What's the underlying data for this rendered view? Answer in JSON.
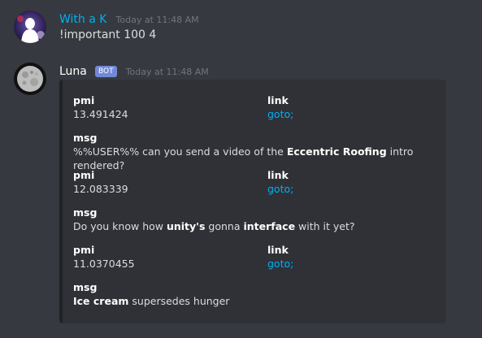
{
  "messages": [
    {
      "author": "With a K",
      "author_color": "#00aff4",
      "timestamp": "Today at 11:48 AM",
      "content": "!important 100 4"
    },
    {
      "author": "Luna",
      "author_color": "#ffffff",
      "bot_tag": "BOT",
      "timestamp": "Today at 11:48 AM"
    }
  ],
  "embed": {
    "results": [
      {
        "pmi_label": "pmi",
        "pmi": "13.491424",
        "link_label": "link",
        "link": "goto;",
        "msg_label": "msg",
        "msg_parts": [
          "%%USER%% can you send a video of the ",
          "Eccentric Roofing",
          " intro rendered?"
        ]
      },
      {
        "pmi_label": "pmi",
        "pmi": "12.083339",
        "link_label": "link",
        "link": "goto;",
        "msg_label": "msg",
        "msg_parts": [
          "Do you know how ",
          "unity's",
          " gonna ",
          "interface",
          " with it yet?"
        ]
      },
      {
        "pmi_label": "pmi",
        "pmi": "11.0370455",
        "link_label": "link",
        "link": "goto;",
        "msg_label": "msg",
        "msg_parts": [
          "Ice cream",
          " supersedes hunger"
        ]
      }
    ]
  }
}
